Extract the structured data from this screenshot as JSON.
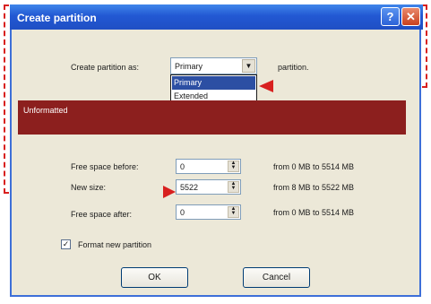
{
  "title": "Create partition",
  "title_buttons": {
    "help": "?",
    "close": "✕"
  },
  "create_as": {
    "label": "Create partition as:",
    "value": "Primary",
    "suffix": "partition."
  },
  "dropdown_options": [
    "Primary",
    "Extended"
  ],
  "partition_area": {
    "label": "Unformatted"
  },
  "fields": [
    {
      "label": "Free space before:",
      "value": "0",
      "range": "from 0 MB  to 5514  MB"
    },
    {
      "label": "New size:",
      "value": "5522",
      "range": "from 8 MB  to 5522  MB"
    },
    {
      "label": "Free space after:",
      "value": "0",
      "range": "from 0 MB  to 5514  MB"
    }
  ],
  "format_checkbox": {
    "label": "Format new partition",
    "checked": true,
    "mark": "✓"
  },
  "buttons": {
    "ok": "OK",
    "cancel": "Cancel"
  },
  "annotation_color": "#d8201f",
  "icons": {
    "dropdown": "chevron-down-icon",
    "spin": "spin-arrows-icon"
  }
}
